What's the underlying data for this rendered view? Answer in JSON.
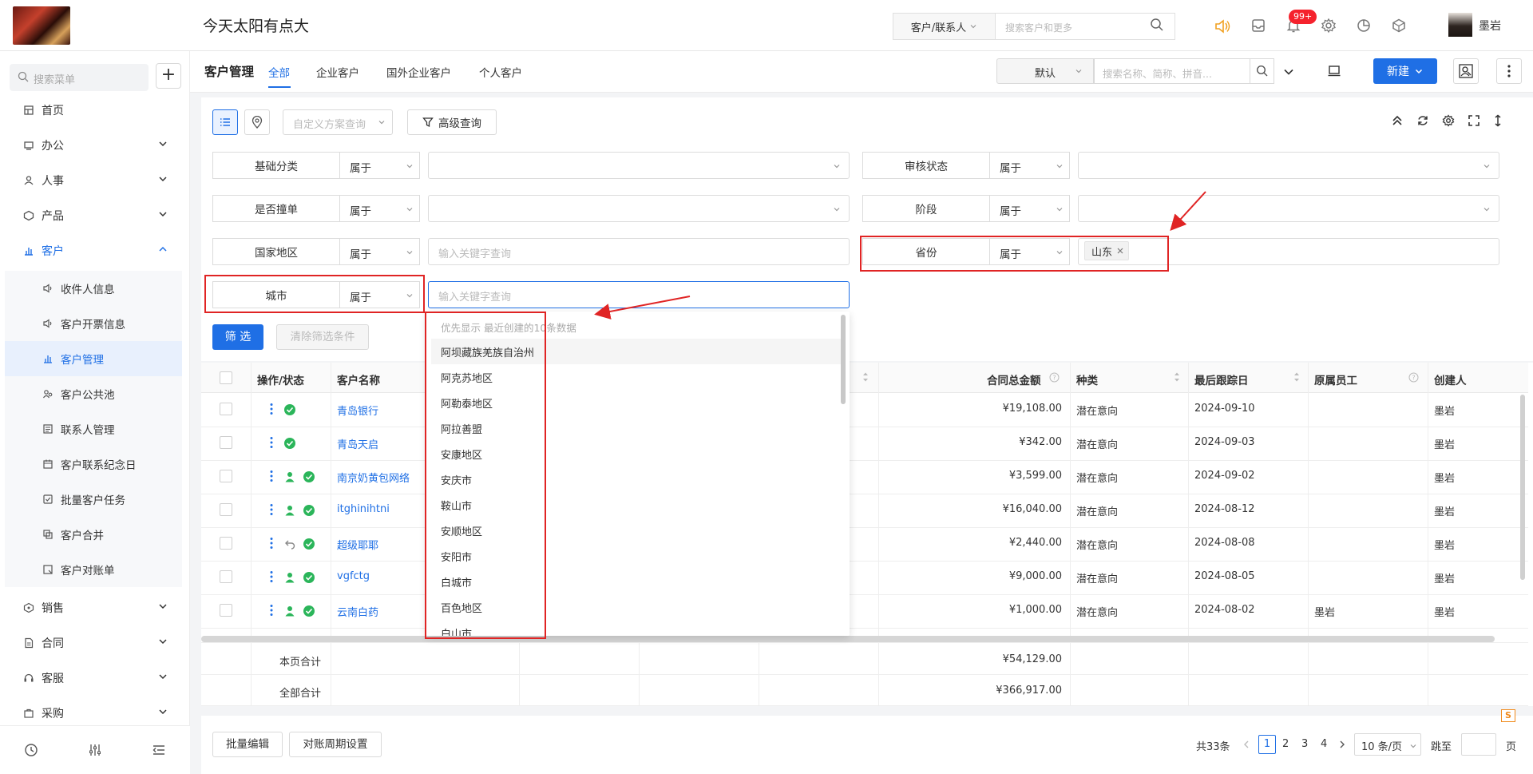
{
  "header": {
    "app_title": "今天太阳有点大",
    "search_scope": "客户/联系人",
    "search_placeholder": "搜索客户和更多",
    "notification_count": "99+",
    "user_name": "墨岩"
  },
  "sidebar": {
    "search_placeholder": "搜索菜单",
    "items": [
      {
        "label": "首页",
        "icon": "home-icon"
      },
      {
        "label": "办公",
        "icon": "office-icon"
      },
      {
        "label": "人事",
        "icon": "people-icon"
      },
      {
        "label": "产品",
        "icon": "cube-icon"
      },
      {
        "label": "客户",
        "icon": "chart-icon"
      },
      {
        "label": "销售",
        "icon": "sales-icon"
      },
      {
        "label": "合同",
        "icon": "contract-icon"
      },
      {
        "label": "客服",
        "icon": "headset-icon"
      },
      {
        "label": "采购",
        "icon": "purchase-icon"
      }
    ],
    "customer_subitems": [
      "收件人信息",
      "客户开票信息",
      "客户管理",
      "客户公共池",
      "联系人管理",
      "客户联系纪念日",
      "批量客户任务",
      "客户合并",
      "客户对账单"
    ]
  },
  "page": {
    "title": "客户管理",
    "tabs": [
      "全部",
      "企业客户",
      "国外企业客户",
      "个人客户"
    ],
    "view_select": "默认",
    "search_placeholder": "搜索名称、简称、拼音...",
    "new_label": "新建"
  },
  "filters": {
    "scheme_placeholder": "自定义方案查询",
    "advanced_label": "高级查询",
    "rows": [
      {
        "label": "基础分类",
        "op": "属于"
      },
      {
        "label": "审核状态",
        "op": "属于"
      },
      {
        "label": "是否撞单",
        "op": "属于"
      },
      {
        "label": "阶段",
        "op": "属于"
      },
      {
        "label": "国家地区",
        "op": "属于",
        "placeholder": "输入关键字查询"
      },
      {
        "label": "省份",
        "op": "属于",
        "tag": "山东"
      },
      {
        "label": "城市",
        "op": "属于",
        "placeholder": "输入关键字查询"
      }
    ],
    "filter_button": "筛 选",
    "clear_button": "清除筛选条件"
  },
  "dropdown": {
    "hint": "优先显示 最近创建的10条数据",
    "options": [
      "阿坝藏族羌族自治州",
      "阿克苏地区",
      "阿勒泰地区",
      "阿拉善盟",
      "安康地区",
      "安庆市",
      "鞍山市",
      "安顺地区",
      "安阳市",
      "白城市",
      "百色地区",
      "白山市"
    ]
  },
  "table": {
    "columns": [
      "操作/状态",
      "客户名称",
      "合同总金额",
      "种类",
      "最后跟踪日",
      "原属员工",
      "创建人"
    ],
    "rows": [
      {
        "name": "青岛银行",
        "amount": "¥19,108.00",
        "type": "潜在意向",
        "date": "2024-09-10",
        "orig": "",
        "creator": "墨岩"
      },
      {
        "name": "青岛天启",
        "amount": "¥342.00",
        "type": "潜在意向",
        "date": "2024-09-03",
        "orig": "",
        "creator": "墨岩"
      },
      {
        "name": "南京奶黄包网络",
        "amount": "¥3,599.00",
        "type": "潜在意向",
        "date": "2024-09-02",
        "orig": "",
        "creator": "墨岩"
      },
      {
        "name": "itghinihtni",
        "amount": "¥16,040.00",
        "type": "潜在意向",
        "date": "2024-08-12",
        "orig": "",
        "creator": "墨岩"
      },
      {
        "name": "超级耶耶",
        "amount": "¥2,440.00",
        "type": "潜在意向",
        "date": "2024-08-08",
        "orig": "",
        "creator": "墨岩"
      },
      {
        "name": "vgfctg",
        "amount": "¥9,000.00",
        "type": "潜在意向",
        "date": "2024-08-05",
        "orig": "",
        "creator": "墨岩"
      },
      {
        "name": "云南白药",
        "amount": "¥1,000.00",
        "type": "潜在意向",
        "date": "2024-08-02",
        "orig": "墨岩",
        "creator": "墨岩"
      }
    ],
    "page_total_label": "本页合计",
    "page_total": "¥54,129.00",
    "all_total_label": "全部合计",
    "all_total": "¥366,917.00"
  },
  "footer": {
    "batch_edit": "批量编辑",
    "period_setting": "对账周期设置",
    "total": "共33条",
    "pages": [
      "1",
      "2",
      "3",
      "4"
    ],
    "page_size": "10 条/页",
    "goto_label": "跳至",
    "page_suffix": "页"
  },
  "colors": {
    "accent": "#1f6fe5",
    "annotation": "#e02424",
    "success": "#2bb55a"
  }
}
